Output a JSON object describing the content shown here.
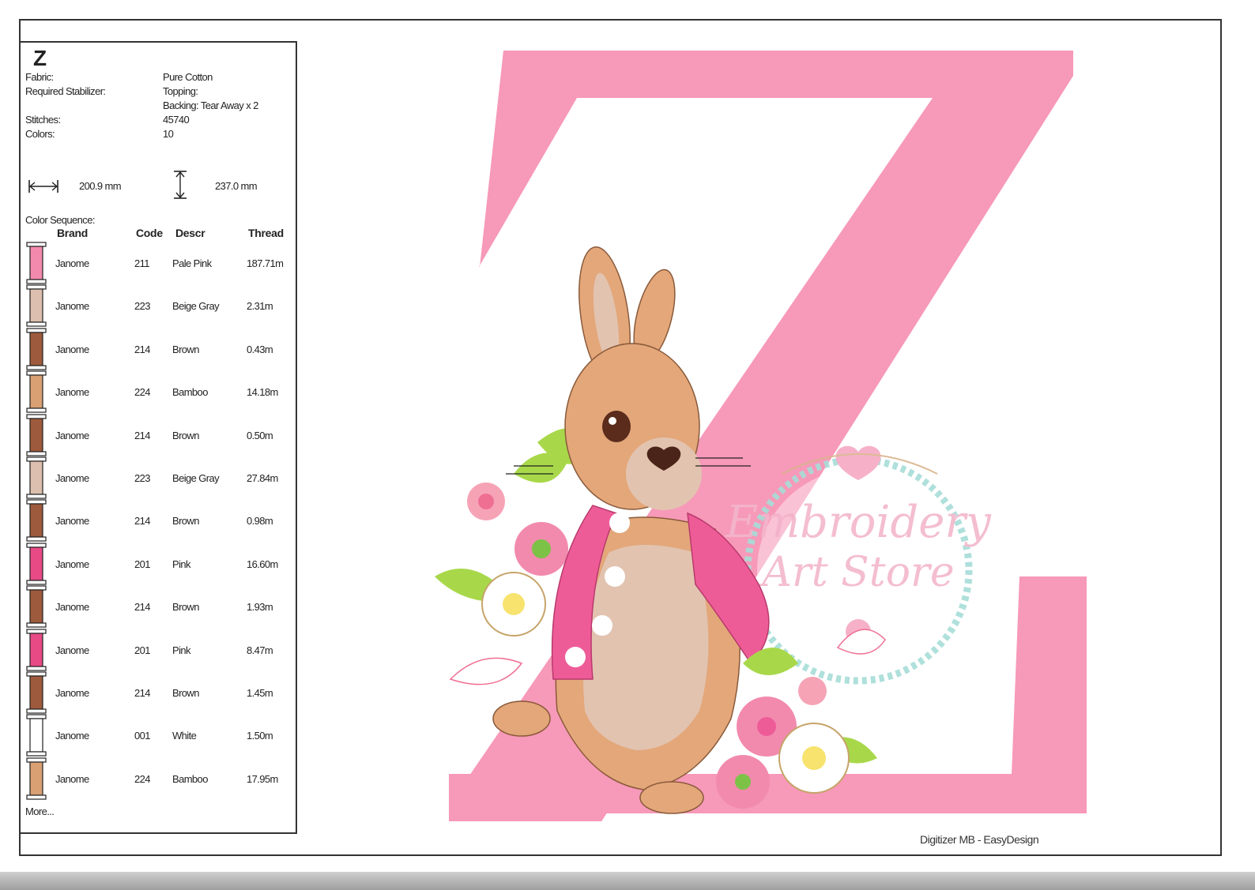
{
  "design": {
    "letter": "Z",
    "fabric_label": "Fabric:",
    "fabric_value": "Pure Cotton",
    "stabilizer_label": "Required Stabilizer:",
    "topping_value": "Topping:",
    "backing_value": "Backing: Tear Away x 2",
    "stitches_label": "Stitches:",
    "stitches_value": "45740",
    "colors_label": "Colors:",
    "colors_value": "10",
    "width_value": "200.9 mm",
    "height_value": "237.0 mm"
  },
  "sequence": {
    "title": "Color Sequence:",
    "headers": {
      "brand": "Brand",
      "code": "Code",
      "descr": "Descr",
      "thread": "Thread"
    },
    "rows": [
      {
        "brand": "Janome",
        "code": "211",
        "descr": "Pale Pink",
        "thread": "187.71m",
        "color": "#f28aae"
      },
      {
        "brand": "Janome",
        "code": "223",
        "descr": "Beige Gray",
        "thread": "2.31m",
        "color": "#dcbfae"
      },
      {
        "brand": "Janome",
        "code": "214",
        "descr": "Brown",
        "thread": "0.43m",
        "color": "#9e5a3c"
      },
      {
        "brand": "Janome",
        "code": "224",
        "descr": "Bamboo",
        "thread": "14.18m",
        "color": "#d9a074"
      },
      {
        "brand": "Janome",
        "code": "214",
        "descr": "Brown",
        "thread": "0.50m",
        "color": "#9e5a3c"
      },
      {
        "brand": "Janome",
        "code": "223",
        "descr": "Beige Gray",
        "thread": "27.84m",
        "color": "#dcbfae"
      },
      {
        "brand": "Janome",
        "code": "214",
        "descr": "Brown",
        "thread": "0.98m",
        "color": "#9e5a3c"
      },
      {
        "brand": "Janome",
        "code": "201",
        "descr": "Pink",
        "thread": "16.60m",
        "color": "#e84a86"
      },
      {
        "brand": "Janome",
        "code": "214",
        "descr": "Brown",
        "thread": "1.93m",
        "color": "#9e5a3c"
      },
      {
        "brand": "Janome",
        "code": "201",
        "descr": "Pink",
        "thread": "8.47m",
        "color": "#e84a86"
      },
      {
        "brand": "Janome",
        "code": "214",
        "descr": "Brown",
        "thread": "1.45m",
        "color": "#9e5a3c"
      },
      {
        "brand": "Janome",
        "code": "001",
        "descr": "White",
        "thread": "1.50m",
        "color": "#ffffff"
      },
      {
        "brand": "Janome",
        "code": "224",
        "descr": "Bamboo",
        "thread": "17.95m",
        "color": "#d9a074"
      }
    ],
    "more_label": "More..."
  },
  "watermark": {
    "line1": "Embroidery",
    "line2": "Art Store"
  },
  "footer": {
    "software": "Digitizer MB - EasyDesign"
  },
  "colors": {
    "letter_pink": "#f799b8",
    "rabbit_fur": "#e3a77a",
    "rabbit_belly": "#e2c3b0",
    "jacket_pink": "#ee5c98",
    "leaf_green": "#a8d84a",
    "wreath_teal": "#9fd9d6",
    "script_pink": "#f5b9cf"
  }
}
